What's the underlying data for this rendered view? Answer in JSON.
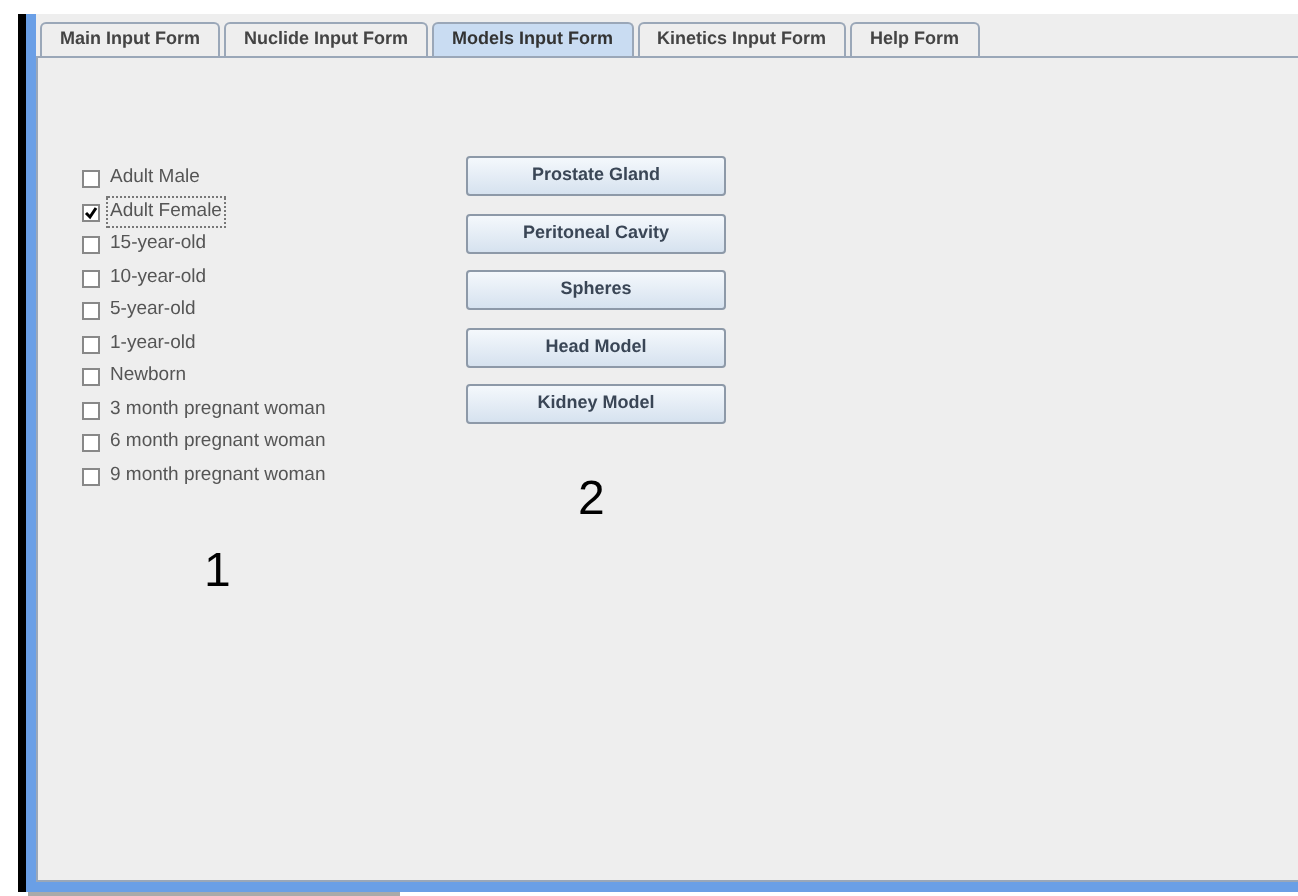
{
  "tabs": [
    {
      "label": "Main Input Form",
      "selected": false
    },
    {
      "label": "Nuclide Input Form",
      "selected": false
    },
    {
      "label": "Models Input Form",
      "selected": true
    },
    {
      "label": "Kinetics Input Form",
      "selected": false
    },
    {
      "label": "Help Form",
      "selected": false
    }
  ],
  "phantoms": [
    {
      "label": "Adult Male",
      "checked": false
    },
    {
      "label": "Adult Female",
      "checked": true
    },
    {
      "label": "15-year-old",
      "checked": false
    },
    {
      "label": "10-year-old",
      "checked": false
    },
    {
      "label": "5-year-old",
      "checked": false
    },
    {
      "label": "1-year-old",
      "checked": false
    },
    {
      "label": "Newborn",
      "checked": false
    },
    {
      "label": "3 month pregnant woman",
      "checked": false
    },
    {
      "label": "6 month pregnant woman",
      "checked": false
    },
    {
      "label": "9 month pregnant woman",
      "checked": false
    }
  ],
  "model_buttons": [
    "Prostate Gland",
    "Peritoneal Cavity",
    "Spheres",
    "Head Model",
    "Kidney Model"
  ],
  "annotations": [
    "1",
    "2"
  ]
}
